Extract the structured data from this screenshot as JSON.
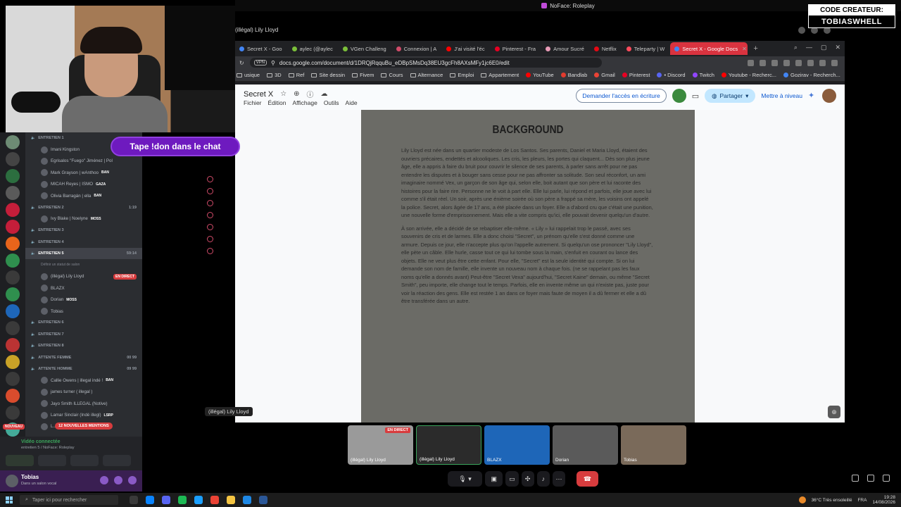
{
  "window_title": "NoFace: Roleplay",
  "call_title": "(illégal) Lily Lloyd",
  "badge": {
    "line1": "CODE CREATEUR:",
    "line2": "TOBIASWHELL"
  },
  "don_pill": "Tape !don dans le chat",
  "browser": {
    "tabs": [
      {
        "label": "Secret X - Goo",
        "color": "#4285f4"
      },
      {
        "label": "aylec (@aylec",
        "color": "#7bbf3a"
      },
      {
        "label": "VGen Challeng",
        "color": "#7bbf3a"
      },
      {
        "label": "Connexion | A",
        "color": "#d04b69"
      },
      {
        "label": "J'ai visité l'éc",
        "color": "#ff0000"
      },
      {
        "label": "Pinterest - Fra",
        "color": "#e60023"
      },
      {
        "label": "Amour Sucré",
        "color": "#e89bb7"
      },
      {
        "label": "Netflix",
        "color": "#e50914"
      },
      {
        "label": "Teleparty | W",
        "color": "#ff4b5c"
      },
      {
        "label": "Secret X - Google Docs",
        "color": "#4285f4"
      }
    ],
    "vpn": "VPN",
    "url": "docs.google.com/document/d/1DRQjRqquBu_eDBpSMsDq38EU3gcFh8AXsMFy1jc6E0/edit",
    "bookmarks": [
      {
        "label": "usique",
        "type": "folder"
      },
      {
        "label": "3D",
        "type": "folder"
      },
      {
        "label": "Ref",
        "type": "folder"
      },
      {
        "label": "Site dessin",
        "type": "folder"
      },
      {
        "label": "Fivem",
        "type": "folder"
      },
      {
        "label": "Cours",
        "type": "folder"
      },
      {
        "label": "Alternance",
        "type": "folder"
      },
      {
        "label": "Emploi",
        "type": "folder"
      },
      {
        "label": "Appartement",
        "type": "folder"
      },
      {
        "label": "YouTube",
        "type": "icon",
        "color": "#ff0000"
      },
      {
        "label": "Bandlab",
        "type": "icon",
        "color": "#e23b2e"
      },
      {
        "label": "Gmail",
        "type": "icon",
        "color": "#ea4335"
      },
      {
        "label": "Pinterest",
        "type": "icon",
        "color": "#e60023"
      },
      {
        "label": "• Discord",
        "type": "icon",
        "color": "#5865f2"
      },
      {
        "label": "Twitch",
        "type": "icon",
        "color": "#9146ff"
      },
      {
        "label": "Youtube - Recherc...",
        "type": "icon",
        "color": "#ff0000"
      },
      {
        "label": "Gozirav - Recherch...",
        "type": "icon",
        "color": "#4285f4"
      }
    ]
  },
  "docs": {
    "title": "Secret X",
    "menu": [
      "Fichier",
      "Édition",
      "Affichage",
      "Outils",
      "Aide"
    ],
    "access_button": "Demander l'accès en écriture",
    "share_button": "Partager",
    "upgrade_button": "Mettre à niveau",
    "heading": "BACKGROUND",
    "paragraph1": "Lily Lloyd est née dans un quartier modeste de Los Santos. Ses parents, Daniel et Maria Lloyd, étaient des ouvriers précaires, endettés et alcooliques. Les cris, les pleurs, les portes qui claquent... Dès son plus jeune âge, elle a appris à faire du bruit pour couvrir le silence de ses parents, à parler sans arrêt pour ne pas entendre les disputes et à bouger sans cesse pour ne pas affronter sa solitude. Son seul réconfort, un ami imaginaire nommé Vex, un garçon de son âge qui, selon elle, boit autant que son père et lui raconte des histoires pour la faire rire. Personne ne le voit à part elle. Elle lui parle, lui répond et parfois, elle joue avec lui comme s'il était réel. Un soir, après une énième soirée où son père a frappé sa mère, les voisins ont appelé la police. Secret, alors âgée de 17 ans, a été placée dans un foyer. Elle a d'abord cru que c'était une punition, une nouvelle forme d'emprisonnement. Mais elle a vite compris qu'ici, elle pouvait devenir quelqu'un d'autre.",
    "paragraph2": "À son arrivée, elle a décidé de se rebaptiser elle-même. « Lily » lui rappelait trop le passé, avec ses souvenirs de cris et de larmes. Elle a donc choisi \"Secret\", un prénom qu'elle s'est donné comme une armure. Depuis ce jour, elle n'accepte plus qu'on l'appelle autrement. Si quelqu'un ose prononcer \"Lily Lloyd\", elle pète un câble. Elle hurle, casse tout ce qui lui tombe sous la main, s'enfuit en courant ou lance des objets. Elle ne veut plus être cette enfant. Pour elle, \"Secret\" est la seule identité qui compte. Si on lui demande son nom de famille, elle invente un nouveau nom à chaque fois. (ne se rappelant pas les faux noms qu'elle a donnés avant) Peut-être \"Secret Vexa\" aujourd'hui, \"Secret Kaine\" demain, ou même \"Secret Smith\", peu importe, elle change tout le temps. Parfois, elle en invente même un qui n'existe pas, juste pour voir la réaction des gens. Elle est restée 1 an dans ce foyer mais faute de moyen il a dû fermer et elle a dû être transférée dans un autre."
  },
  "share_label": "(illégal) Lily Lloyd",
  "discord": {
    "channels": [
      {
        "kind": "group",
        "label": "ENTRETIEN 1"
      },
      {
        "kind": "user",
        "label": "Imani Kingston"
      },
      {
        "kind": "user",
        "label": "Egrisalos \"Fuego\" Jiménez | Pol"
      },
      {
        "kind": "user",
        "label": "Mark Grayson | wAnthoo",
        "tag": "BAN"
      },
      {
        "kind": "user",
        "label": "MICAH Reyes | ISMO",
        "tag": "GAZA"
      },
      {
        "kind": "user",
        "label": "Olivia Barragán | ella",
        "tag": "BAN"
      },
      {
        "kind": "group",
        "label": "ENTRETIEN 2",
        "count": "1:19"
      },
      {
        "kind": "user",
        "label": "Ivy Blake | Noelyne",
        "tag": "MOSS"
      },
      {
        "kind": "group",
        "label": "ENTRETIEN 3"
      },
      {
        "kind": "group",
        "label": "ENTRETIEN 4"
      },
      {
        "kind": "group",
        "label": "ENTRETIEN 5",
        "count": "59:14",
        "selected": true
      },
      {
        "kind": "note",
        "label": "Définir un statut de salon"
      },
      {
        "kind": "user",
        "label": "(illégal) Lily Lloyd",
        "live": "EN DIRECT"
      },
      {
        "kind": "user",
        "label": "BLAZX"
      },
      {
        "kind": "user",
        "label": "Dorian",
        "tag": "MOSS"
      },
      {
        "kind": "user",
        "label": "Tobias"
      },
      {
        "kind": "group",
        "label": "ENTRETIEN 6"
      },
      {
        "kind": "group",
        "label": "ENTRETIEN 7"
      },
      {
        "kind": "group",
        "label": "ENTRETIEN 8"
      },
      {
        "kind": "group",
        "label": "ATTENTE FEMME",
        "count": "00 99"
      },
      {
        "kind": "group",
        "label": "ATTENTE HOMME",
        "count": "09 99"
      },
      {
        "kind": "user",
        "label": "Callie Owens | illegal indé !",
        "tag": "BAN"
      },
      {
        "kind": "user",
        "label": "james turner ( illegal )"
      },
      {
        "kind": "user",
        "label": "Jayo Smith ILLEGAL (Notive)"
      },
      {
        "kind": "user",
        "label": "Lamar Sinclair (Indé illegl)",
        "tag": "LSRP"
      },
      {
        "kind": "user",
        "label": "L..."
      }
    ],
    "mentions": "12 NOUVELLES MENTIONS",
    "nouveau": "NOUVEAU",
    "voice_connected": "Vidéo connectée",
    "voice_channel": "entretien 5 / NoFace: Roleplay",
    "user_name": "Tobias",
    "user_status": "Dans un salon vocal"
  },
  "tiles": [
    {
      "label": "(illégal) Lily Lloyd",
      "live": "EN DIRECT",
      "bg": "#9a9a9a"
    },
    {
      "label": "(illégal) Lily Lloyd",
      "bg": "#2b2b2b"
    },
    {
      "label": "BLAZX",
      "bg": "#1e66b8"
    },
    {
      "label": "Dorian",
      "bg": "#5a5a5a"
    },
    {
      "label": "Tobias",
      "bg": "#7a6a5a"
    }
  ],
  "taskbar": {
    "search_placeholder": "Taper ici pour rechercher",
    "weather": "36°C Très ensoleillé",
    "lang": "FRA",
    "time": "19:28",
    "date": "14/08/2026"
  }
}
